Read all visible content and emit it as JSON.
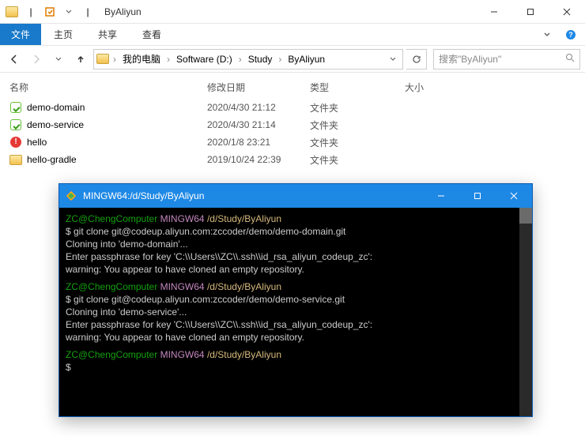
{
  "window": {
    "title": "ByAliyun",
    "qat_separator": "|"
  },
  "ribbon": {
    "file": "文件",
    "tabs": [
      "主页",
      "共享",
      "查看"
    ],
    "expand_icon": "chevron-down"
  },
  "address": {
    "segments": [
      "我的电脑",
      "Software (D:)",
      "Study",
      "ByAliyun"
    ]
  },
  "search": {
    "placeholder": "搜索\"ByAliyun\""
  },
  "columns": {
    "name": "名称",
    "modified": "修改日期",
    "type": "类型",
    "size": "大小"
  },
  "rows": [
    {
      "icon": "green",
      "name": "demo-domain",
      "modified": "2020/4/30 21:12",
      "type": "文件夹",
      "size": ""
    },
    {
      "icon": "green",
      "name": "demo-service",
      "modified": "2020/4/30 21:14",
      "type": "文件夹",
      "size": ""
    },
    {
      "icon": "red",
      "name": "hello",
      "modified": "2020/1/8 23:21",
      "type": "文件夹",
      "size": ""
    },
    {
      "icon": "folder",
      "name": "hello-gradle",
      "modified": "2019/10/24 22:39",
      "type": "文件夹",
      "size": ""
    }
  ],
  "terminal": {
    "title": "MINGW64:/d/Study/ByAliyun",
    "blocks": [
      {
        "prompt_user": "ZC@ChengComputer",
        "prompt_env": "MINGW64",
        "prompt_path": "/d/Study/ByAliyun",
        "lines": [
          "$ git clone git@codeup.aliyun.com:zccoder/demo/demo-domain.git",
          "Cloning into 'demo-domain'...",
          "Enter passphrase for key 'C:\\\\Users\\\\ZC\\\\.ssh\\\\id_rsa_aliyun_codeup_zc':",
          "warning: You appear to have cloned an empty repository."
        ]
      },
      {
        "prompt_user": "ZC@ChengComputer",
        "prompt_env": "MINGW64",
        "prompt_path": "/d/Study/ByAliyun",
        "lines": [
          "$ git clone git@codeup.aliyun.com:zccoder/demo/demo-service.git",
          "Cloning into 'demo-service'...",
          "Enter passphrase for key 'C:\\\\Users\\\\ZC\\\\.ssh\\\\id_rsa_aliyun_codeup_zc':",
          "warning: You appear to have cloned an empty repository."
        ]
      },
      {
        "prompt_user": "ZC@ChengComputer",
        "prompt_env": "MINGW64",
        "prompt_path": "/d/Study/ByAliyun",
        "lines": [
          "$"
        ]
      }
    ]
  }
}
